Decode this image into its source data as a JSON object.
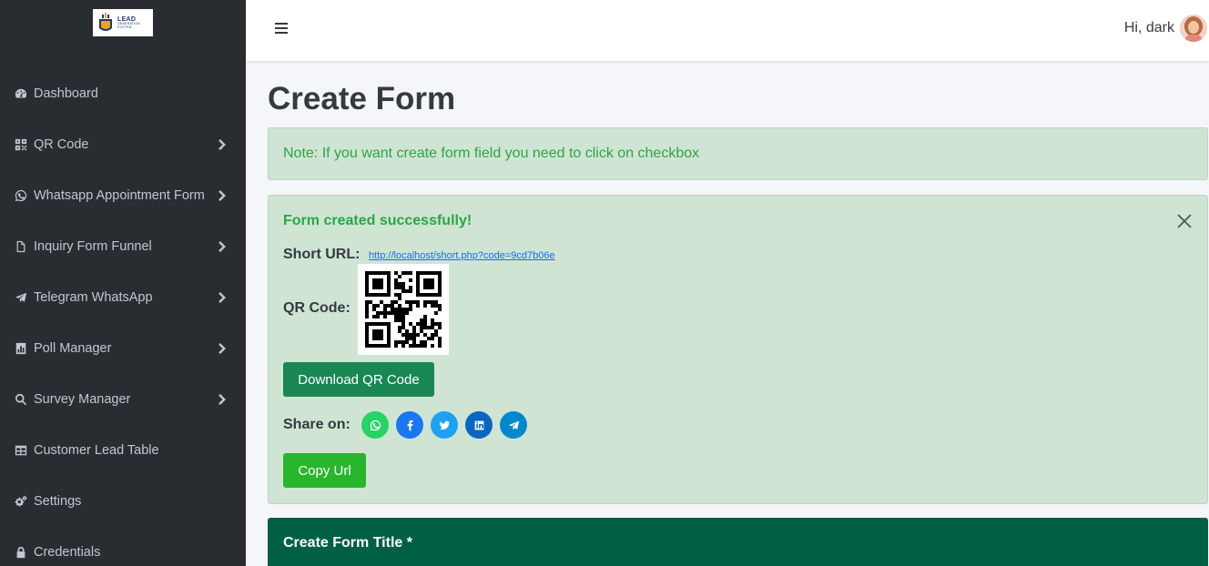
{
  "app": {
    "logo_word1": "LEAD",
    "logo_word2": "GENERATION SYSTEM"
  },
  "sidebar": {
    "items": [
      {
        "label": "Dashboard",
        "icon": "dashboard-icon",
        "has_submenu": false
      },
      {
        "label": "QR Code",
        "icon": "qrcode-icon",
        "has_submenu": true
      },
      {
        "label": "Whatsapp Appointment Form",
        "icon": "whatsapp-icon",
        "has_submenu": true
      },
      {
        "label": "Inquiry Form Funnel",
        "icon": "file-icon",
        "has_submenu": true
      },
      {
        "label": "Telegram WhatsApp",
        "icon": "telegram-icon",
        "has_submenu": true
      },
      {
        "label": "Poll Manager",
        "icon": "poll-icon",
        "has_submenu": true
      },
      {
        "label": "Survey Manager",
        "icon": "search-icon",
        "has_submenu": true
      },
      {
        "label": "Customer Lead Table",
        "icon": "table-icon",
        "has_submenu": false
      },
      {
        "label": "Settings",
        "icon": "gears-icon",
        "has_submenu": false
      },
      {
        "label": "Credentials",
        "icon": "lock-icon",
        "has_submenu": false
      }
    ]
  },
  "header": {
    "greeting": "Hi, dark"
  },
  "main": {
    "title": "Create Form",
    "note": "Note: If you want create form field you need to click on checkbox",
    "success": {
      "heading": "Form created successfully!",
      "short_url_label": "Short URL:",
      "short_url": "http://localhost/short.php?code=9cd7b06e",
      "qr_label": "QR Code:",
      "download_label": "Download QR Code",
      "share_label": "Share on:",
      "share_targets": [
        {
          "name": "whatsapp",
          "color": "#25d366"
        },
        {
          "name": "facebook",
          "color": "#1877f2"
        },
        {
          "name": "twitter",
          "color": "#1da1f2"
        },
        {
          "name": "linkedin",
          "color": "#0a66c2"
        },
        {
          "name": "telegram",
          "color": "#0088cc"
        }
      ],
      "copy_label": "Copy Url"
    },
    "form_card_title": "Create Form Title *"
  },
  "colors": {
    "sidebar_bg": "#292d31",
    "alert_bg": "#d0e4d3",
    "alert_text": "#28a745",
    "download_btn": "#198754",
    "copy_btn": "#28b62c",
    "card_header": "#015f43"
  }
}
